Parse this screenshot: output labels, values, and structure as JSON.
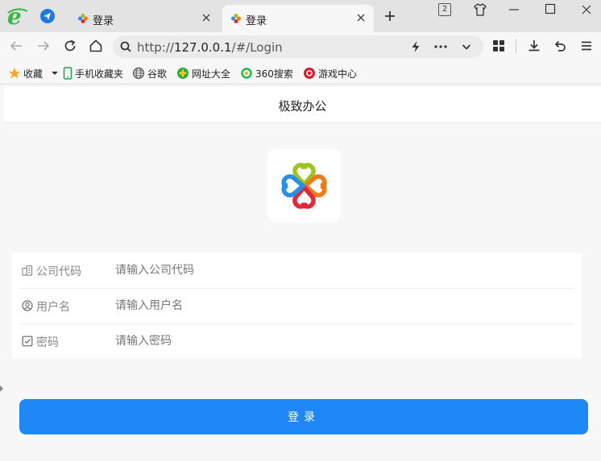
{
  "tabs": [
    {
      "title": "登录",
      "active": false
    },
    {
      "title": "登录",
      "active": true
    }
  ],
  "tab_count": "2",
  "address": {
    "prefix": "http://",
    "host": "127.0.0.1",
    "path": "/#/Login"
  },
  "bookmarks": [
    {
      "label": "收藏",
      "icon": "star-icon"
    },
    {
      "label": "手机收藏夹",
      "icon": "phone-icon"
    },
    {
      "label": "谷歌",
      "icon": "globe-icon"
    },
    {
      "label": "网址大全",
      "icon": "hao-icon"
    },
    {
      "label": "360搜索",
      "icon": "so-icon"
    },
    {
      "label": "游戏中心",
      "icon": "game-icon"
    }
  ],
  "page": {
    "title": "极致办公",
    "fields": [
      {
        "label": "公司代码",
        "placeholder": "请输入公司代码",
        "icon": "building-icon"
      },
      {
        "label": "用户名",
        "placeholder": "请输入用户名",
        "icon": "user-icon"
      },
      {
        "label": "密码",
        "placeholder": "请输入密码",
        "icon": "check-square-icon"
      }
    ],
    "login_button": "登录"
  },
  "colors": {
    "primary": "#1e88f6",
    "logo_green": "#9bc51f",
    "logo_orange": "#f07a1a",
    "logo_red": "#e0293d",
    "logo_blue": "#2a8fe0"
  }
}
